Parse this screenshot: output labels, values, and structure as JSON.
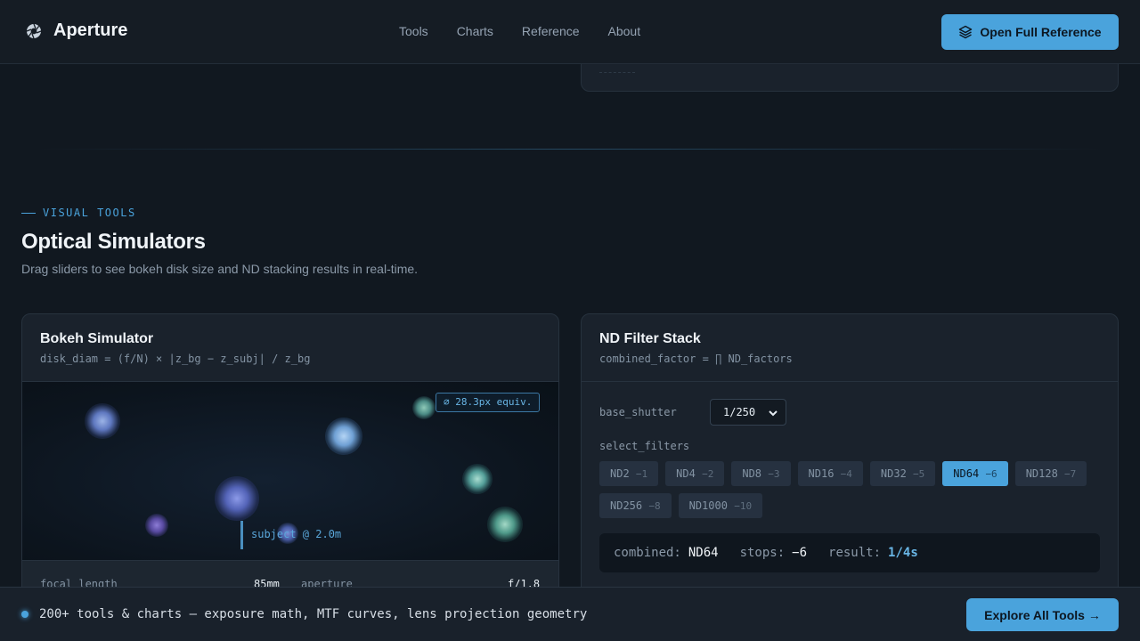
{
  "brand": {
    "name": "Aperture",
    "logo_icon": "aperture-icon"
  },
  "nav": {
    "items": [
      "Tools",
      "Charts",
      "Reference",
      "About"
    ]
  },
  "header_button": {
    "label": "Open Full Reference",
    "icon": "layers-icon"
  },
  "section": {
    "eyebrow": "VISUAL TOOLS",
    "title": "Optical Simulators",
    "subtitle": "Drag sliders to see bokeh disk size and ND stacking results in real-time."
  },
  "bokeh": {
    "title": "Bokeh Simulator",
    "formula": "disk_diam = (f/N) × |z_bg − z_subj| / z_bg",
    "equiv_badge": "⌀ 28.3px equiv.",
    "subject_label": "subject @ 2.0m",
    "sliders": {
      "focal_label": "focal length",
      "focal_value": "85mm",
      "aperture_label": "aperture",
      "aperture_value": "f/1.8"
    }
  },
  "nd": {
    "title": "ND Filter Stack",
    "formula": "combined_factor = ∏ ND_factors",
    "shutter_label": "base_shutter",
    "shutter_value": "1/250",
    "filters_label": "select_filters",
    "filters": [
      {
        "name": "ND2",
        "stops": "−1"
      },
      {
        "name": "ND4",
        "stops": "−2"
      },
      {
        "name": "ND8",
        "stops": "−3"
      },
      {
        "name": "ND16",
        "stops": "−4"
      },
      {
        "name": "ND32",
        "stops": "−5"
      },
      {
        "name": "ND64",
        "stops": "−6"
      },
      {
        "name": "ND128",
        "stops": "−7"
      },
      {
        "name": "ND256",
        "stops": "−8"
      },
      {
        "name": "ND1000",
        "stops": "−10"
      }
    ],
    "selected_filter": "ND64",
    "result": {
      "combined_key": "combined:",
      "combined_value": "ND64",
      "stops_key": "stops:",
      "stops_value": "−6",
      "result_key": "result:",
      "result_value": "1/4s"
    }
  },
  "bottom_bar": {
    "text": "200+ tools & charts — exposure math, MTF curves, lens projection geometry",
    "button": "Explore All Tools →"
  },
  "colors": {
    "accent": "#4aa3dc",
    "background": "#111820",
    "card": "#1a222c"
  }
}
